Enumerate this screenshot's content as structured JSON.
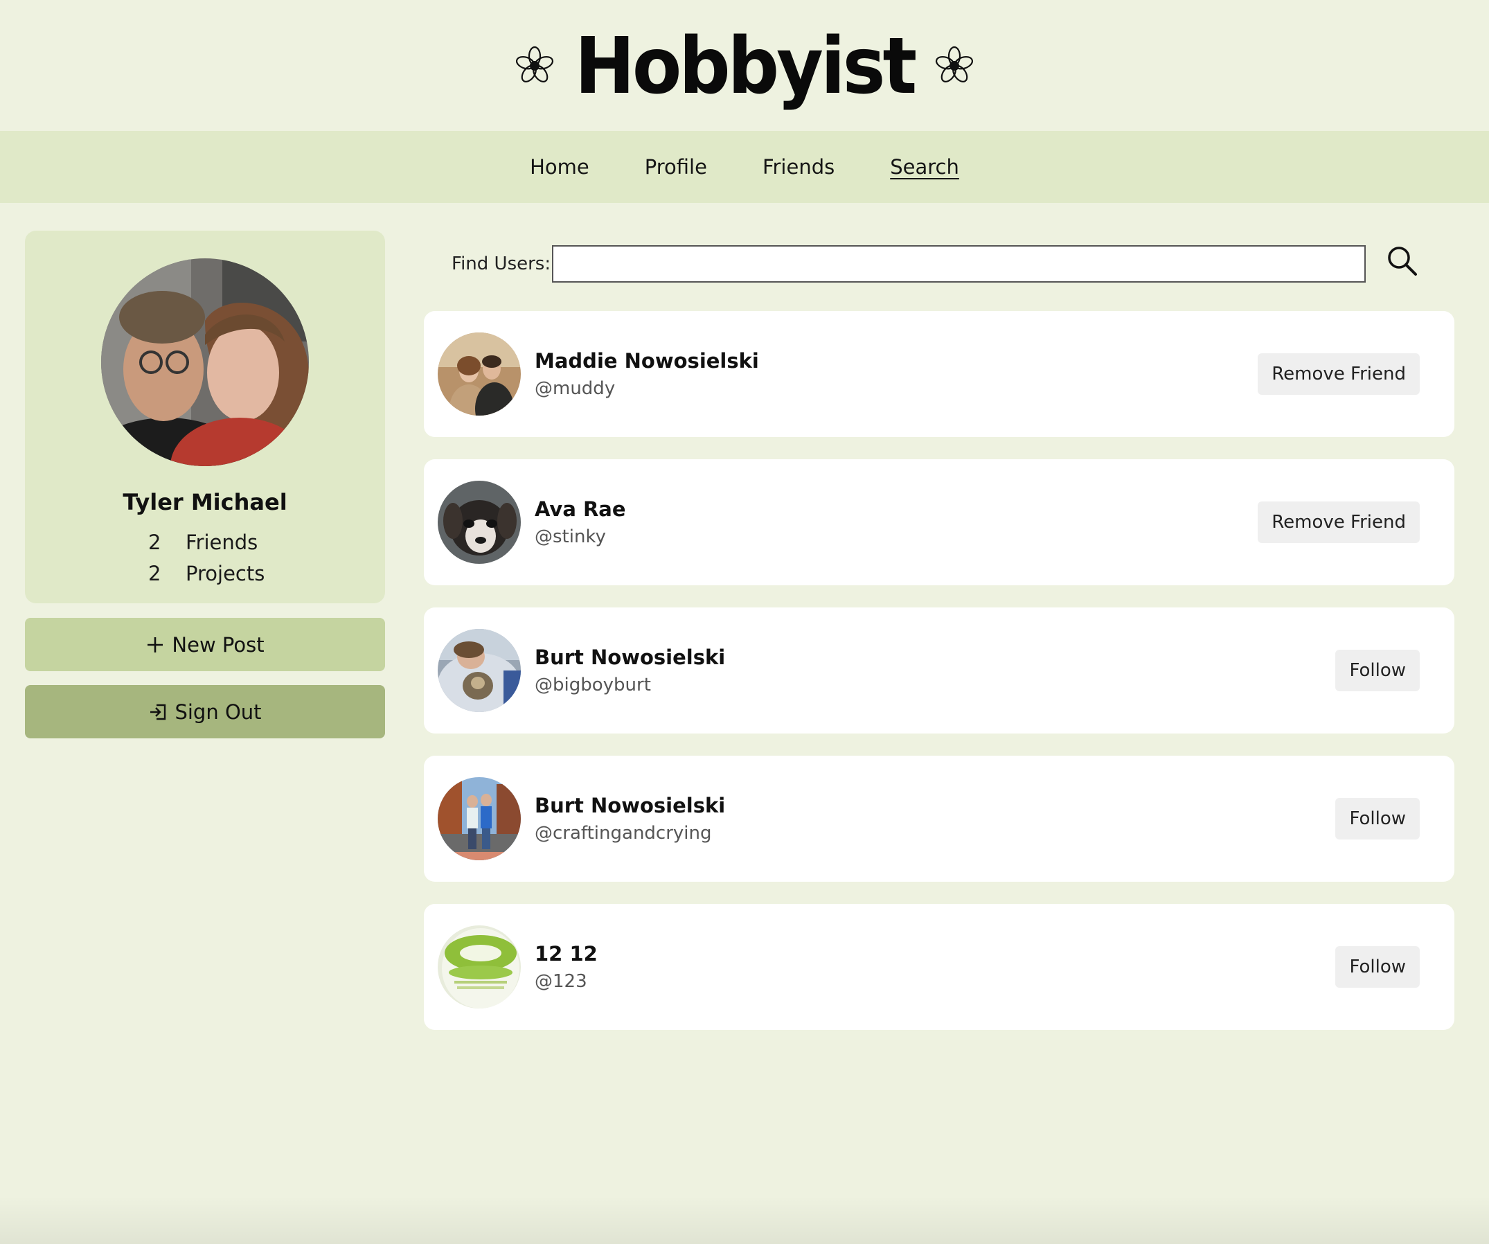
{
  "app": {
    "logo_text": "Hobbyist",
    "logo_icon": "flower-icon"
  },
  "nav": {
    "items": [
      {
        "label": "Home"
      },
      {
        "label": "Profile"
      },
      {
        "label": "Friends"
      },
      {
        "label": "Search",
        "active": true
      }
    ]
  },
  "profile": {
    "name": "Tyler Michael",
    "friends_count": "2",
    "friends_label": "Friends",
    "projects_count": "2",
    "projects_label": "Projects"
  },
  "actions": {
    "new_post_label": "New Post",
    "new_post_icon": "plus-icon",
    "sign_out_label": "Sign Out",
    "sign_out_icon": "sign-out-icon"
  },
  "search": {
    "label": "Find Users:",
    "value": "",
    "placeholder": "",
    "icon": "search-icon"
  },
  "users": [
    {
      "name": "Maddie Nowosielski",
      "handle": "@muddy",
      "action": "Remove Friend"
    },
    {
      "name": "Ava Rae",
      "handle": "@stinky",
      "action": "Remove Friend"
    },
    {
      "name": "Burt Nowosielski",
      "handle": "@bigboyburt",
      "action": "Follow"
    },
    {
      "name": "Burt Nowosielski",
      "handle": "@craftingandcrying",
      "action": "Follow"
    },
    {
      "name": "12 12",
      "handle": "@123",
      "action": "Follow"
    }
  ],
  "colors": {
    "page_background": "#eef2e0",
    "nav_background": "#e0e9c8",
    "new_post_button": "#c5d4a0",
    "sign_out_button": "#a6b67e",
    "card_background": "#ffffff",
    "user_button": "#efefef"
  }
}
